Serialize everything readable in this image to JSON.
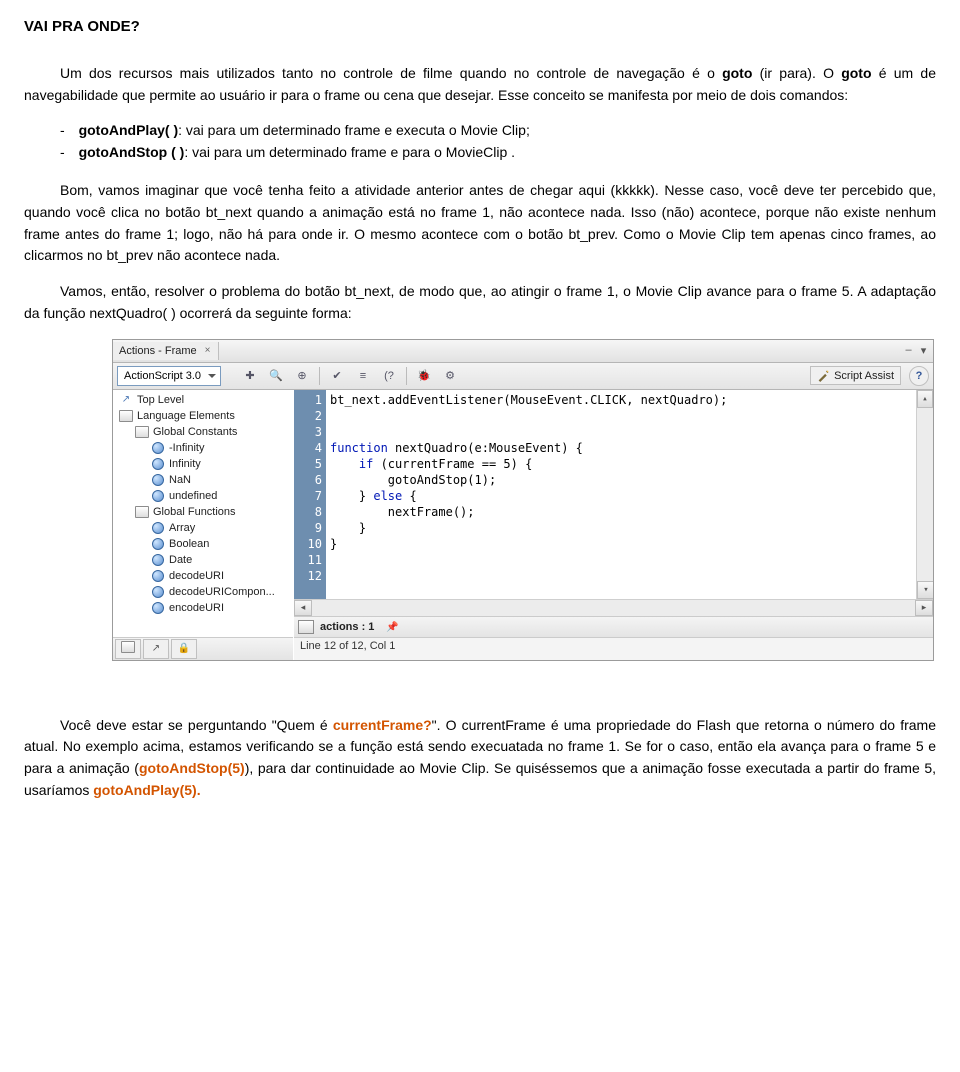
{
  "doc": {
    "title": "VAI PRA ONDE?",
    "p1_a": "Um dos recursos mais utilizados tanto no controle de filme quando no controle de navegação é o ",
    "p1_b": "goto",
    "p1_c": " (ir para). O ",
    "p1_d": "goto",
    "p1_e": " é um de navegabilidade que permite ao usuário ir para o frame ou cena que desejar. Esse conceito se manifesta por meio de dois comandos:",
    "li1_a": "gotoAndPlay( )",
    "li1_b": ": vai para um determinado frame e executa o Movie Clip;",
    "li2_a": "gotoAndStop ( )",
    "li2_b": ": vai para um determinado frame e para o MovieClip .",
    "p2": "Bom, vamos imaginar que você tenha feito a atividade anterior antes de chegar aqui (kkkkk). Nesse caso, você deve ter percebido que, quando você clica no botão bt_next quando a animação está no frame 1, não acontece nada. Isso (não) acontece, porque não existe nenhum frame antes do frame 1; logo, não há para onde ir. O mesmo acontece com o botão bt_prev. Como o Movie Clip tem apenas cinco frames, ao clicarmos no bt_prev não acontece nada.",
    "p3": "Vamos, então, resolver o problema do botão bt_next, de modo que, ao atingir o frame 1, o Movie Clip avance para o frame 5. A adaptação da função nextQuadro( ) ocorrerá da seguinte forma:",
    "p4_a": "Você deve estar se perguntando \"Quem é ",
    "p4_b": "currentFrame?",
    "p4_c": "\". O currentFrame é uma propriedade do Flash que retorna o número do frame atual. No exemplo acima, estamos verificando se a função está sendo execuatada no frame 1. Se for o caso, então ela avança para o frame 5 e para a animação (",
    "p4_d": "gotoAndStop(5)",
    "p4_e": "), para dar continuidade ao Movie Clip. Se quiséssemos que a animação fosse executada a partir do frame 5, usaríamos ",
    "p4_f": "gotoAndPlay(5).",
    "indent_pad": "        "
  },
  "panel": {
    "tab_label": "Actions - Frame",
    "language": "ActionScript 3.0",
    "script_assist": "Script Assist",
    "path_label": "actions : 1",
    "status": "Line 12 of 12, Col 1",
    "nav": [
      {
        "icon": "expand",
        "indent": 0,
        "label": "Top Level"
      },
      {
        "icon": "book",
        "indent": 0,
        "label": "Language Elements"
      },
      {
        "icon": "book",
        "indent": 1,
        "label": "Global Constants"
      },
      {
        "icon": "circle",
        "indent": 2,
        "label": "-Infinity"
      },
      {
        "icon": "circle",
        "indent": 2,
        "label": "Infinity"
      },
      {
        "icon": "circle",
        "indent": 2,
        "label": "NaN"
      },
      {
        "icon": "circle",
        "indent": 2,
        "label": "undefined"
      },
      {
        "icon": "book",
        "indent": 1,
        "label": "Global Functions"
      },
      {
        "icon": "circle",
        "indent": 2,
        "label": "Array"
      },
      {
        "icon": "circle",
        "indent": 2,
        "label": "Boolean"
      },
      {
        "icon": "circle",
        "indent": 2,
        "label": "Date"
      },
      {
        "icon": "circle",
        "indent": 2,
        "label": "decodeURI"
      },
      {
        "icon": "circle",
        "indent": 2,
        "label": "decodeURICompon..."
      },
      {
        "icon": "circle",
        "indent": 2,
        "label": "encodeURI"
      }
    ],
    "code_lines": [
      "bt_next.addEventListener(MouseEvent.CLICK, nextQuadro);",
      "",
      "",
      "function nextQuadro(e:MouseEvent) {",
      "    if (currentFrame == 5) {",
      "        gotoAndStop(1);",
      "    } else {",
      "        nextFrame();",
      "    }",
      "}",
      "",
      ""
    ]
  }
}
